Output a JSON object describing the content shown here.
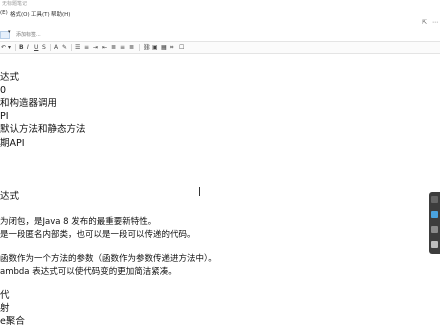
{
  "window": {
    "title": "无标题笔记"
  },
  "menu": {
    "items": [
      "(E)",
      "格式(O)",
      "工具(T)",
      "帮助(H)"
    ],
    "right_icons": [
      "share-icon",
      "more-icon"
    ]
  },
  "tags": {
    "add_label": "添加标签..."
  },
  "toolbar": {
    "bold": "B",
    "italic": "I",
    "underline": "U",
    "strike": "S",
    "list": "☰",
    "numbered": "≡",
    "indent": "⇥",
    "outdent": "⇤",
    "link": "⛓",
    "image": "▣",
    "table": "▦",
    "code": "⌗"
  },
  "document": {
    "lines": [
      "达式",
      "0",
      "和构造器调用",
      "PI",
      "默认方法和静态方法",
      "期API",
      "达式",
      "为闭包，是Java 8 发布的最重要新特性。",
      "是一段匿名内部类，也可以是一段可以传递的代码。",
      "函数作为一个方法的参数（函数作为参数传递进方法中）。",
      "ambda 表达式可以使代码变的更加简洁紧凑。",
      "代",
      "射",
      "e聚合"
    ]
  },
  "side_panel": {
    "icons": [
      "back-icon",
      "note-icon",
      "share-icon",
      "mobile-icon"
    ]
  }
}
